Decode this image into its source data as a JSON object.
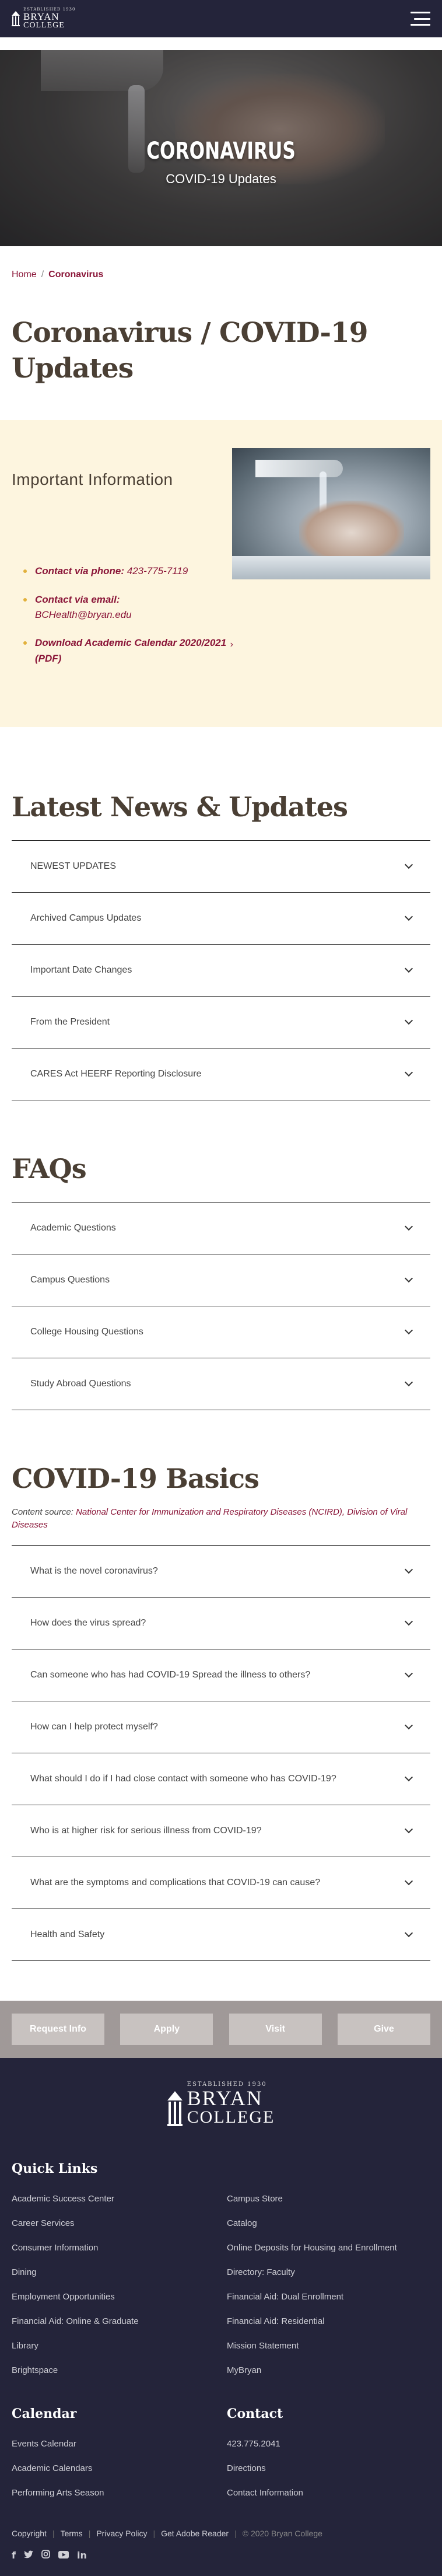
{
  "header": {
    "logo_line1": "ESTABLISHED 1930",
    "logo_line2": "BRYAN",
    "logo_line3": "COLLEGE"
  },
  "hero": {
    "title": "CORONAVIRUS",
    "subtitle": "COVID-19 Updates"
  },
  "breadcrumb": {
    "home": "Home",
    "separator": "/",
    "current": "Coronavirus"
  },
  "page_title": "Coronavirus / COVID-19 Updates",
  "important": {
    "heading": "Important Information",
    "links": [
      {
        "label": "Contact via phone:",
        "value": "423-775-7119"
      },
      {
        "label": "Contact via email:",
        "value": "BCHealth@bryan.edu"
      },
      {
        "label": "Download Academic Calendar 2020/2021 (PDF)",
        "value": ""
      }
    ],
    "arrow": "›"
  },
  "news": {
    "heading": "Latest News & Updates",
    "items": [
      "NEWEST UPDATES",
      "Archived Campus Updates",
      "Important Date Changes",
      "From the President",
      "CARES Act HEERF Reporting Disclosure"
    ]
  },
  "faqs": {
    "heading": "FAQs",
    "items": [
      "Academic Questions",
      "Campus Questions",
      "College Housing Questions",
      "Study Abroad Questions"
    ]
  },
  "basics": {
    "heading": "COVID-19 Basics",
    "source_label": "Content source:",
    "source_link": "National Center for Immunization and Respiratory Diseases (NCIRD), Division of Viral Diseases",
    "items": [
      "What is the novel coronavirus?",
      "How does the virus spread?",
      "Can someone who has had COVID-19 Spread the illness to others?",
      "How can I help protect myself?",
      "What should I do if I had close contact with someone who has COVID-19?",
      "Who is at higher risk for serious illness from COVID-19?",
      "What are the symptoms and complications that COVID-19 can cause?",
      "Health and Safety"
    ]
  },
  "cta": [
    "Request Info",
    "Apply",
    "Visit",
    "Give"
  ],
  "footer": {
    "logo_line1": "ESTABLISHED 1930",
    "logo_line2": "BRYAN",
    "logo_line3": "COLLEGE",
    "quick_links_heading": "Quick Links",
    "quick_links": [
      "Academic Success Center",
      "Campus Store",
      "Career Services",
      "Catalog",
      "Consumer Information",
      "Online Deposits for Housing and Enrollment",
      "Dining",
      "Directory: Faculty",
      "Employment Opportunities",
      "Financial Aid: Dual Enrollment",
      "Financial Aid: Online & Graduate",
      "Financial Aid: Residential",
      "Library",
      "Mission Statement",
      "Brightspace",
      "MyBryan"
    ],
    "calendar_heading": "Calendar",
    "calendar_links": [
      "Events Calendar",
      "Academic Calendars",
      "Performing Arts Season"
    ],
    "contact_heading": "Contact",
    "contact_links": [
      "423.775.2041",
      "Directions",
      "Contact Information"
    ],
    "bottom_links": [
      "Copyright",
      "Terms",
      "Privacy Policy",
      "Get Adobe Reader"
    ],
    "copyright": "© 2020 Bryan College",
    "social": [
      "f",
      "t",
      "ig",
      "yt",
      "in"
    ]
  }
}
